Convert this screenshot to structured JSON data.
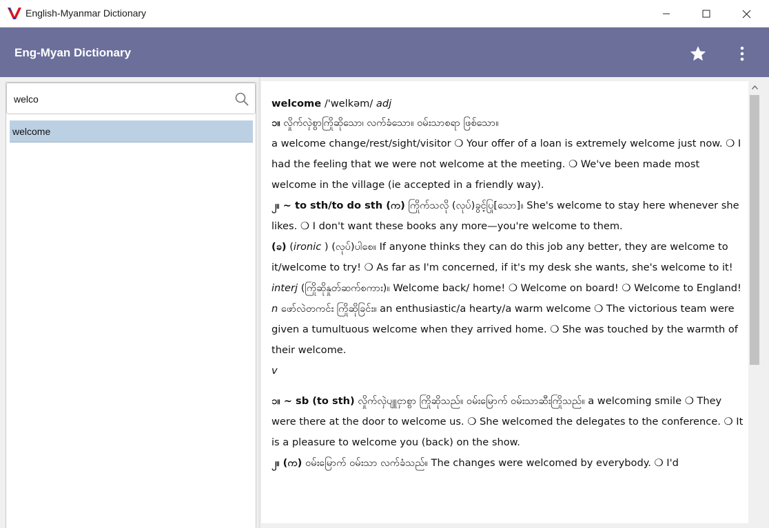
{
  "window": {
    "title": "English-Myanmar Dictionary"
  },
  "appbar": {
    "title": "Eng-Myan Dictionary",
    "favorite_icon": "star-icon",
    "menu_icon": "more-vert-icon"
  },
  "search": {
    "value": "welco",
    "placeholder": ""
  },
  "results": [
    {
      "label": "welcome"
    }
  ],
  "colors": {
    "appbar": "#6b6f9a",
    "selected_row": "#bcd0e4",
    "logo_red": "#e0141c",
    "logo_blue": "#1e3ea8"
  },
  "entry": {
    "headword": "welcome",
    "pronunciation": "/'welkəm/",
    "pos_adj": "adj",
    "adj1_num": "၁။",
    "adj1_myan": "လှိုက်လှဲစွာကြိုဆိုသော၊ လက်ခံသော။ ဝမ်းသာစရာ ဖြစ်သော။",
    "adj1_text": "a welcome change/rest/sight/visitor ❍ Your offer of a loan is extremely welcome just now. ❍ I had the feeling that we were not welcome at the meeting. ❍ We've been made most welcome in the village (ie accepted in a friendly way).",
    "adj2_bold": "၂။ ~ to sth/to do sth (က)",
    "adj2_text": "ကြိုက်သလို (လုပ်)ခွင့်ပြု[သော]။ She's welcome to stay here whenever she likes. ❍ I don't want these books any more—you're welcome to them.",
    "adj2b_bold": "(ခ)",
    "adj2b_label": "ironic",
    "adj2b_text": "(လုပ်)ပါစေ။ If anyone thinks they can do this job any better, they are welcome to it/welcome to try! ❍ As far as I'm concerned, if it's my desk she wants, she's welcome to it!",
    "interj_label": "interj",
    "interj_text": "(ကြိုဆိုနှုတ်ဆက်စကား)။ Welcome back/ home! ❍ Welcome on board! ❍ Welcome to England!",
    "noun_label": "n",
    "noun_text": "ဖော်လဲတကင်း ကြိုဆိုခြင်း။ an enthusiastic/a hearty/a warm welcome ❍ The victorious team were given a tumultuous welcome when they arrived home. ❍ She was touched by the warmth of their welcome.",
    "verb_label": "v",
    "v1_bold": "၁။ ~ sb (to sth)",
    "v1_text": "လှိုက်လှဲပျူငှာစွာ ကြိုဆိုသည်။ ဝမ်းမြောက် ဝမ်းသာဆီးကြိုသည်။ a welcoming smile ❍ They were there at the door to welcome us. ❍ She welcomed the delegates to the conference. ❍ It is a pleasure to welcome you (back) on the show.",
    "v2_bold": "၂။ (က)",
    "v2_text": "ဝမ်းမြောက် ဝမ်းသာ လက်ခံသည်။ The changes were welcomed by everybody. ❍ I'd"
  }
}
